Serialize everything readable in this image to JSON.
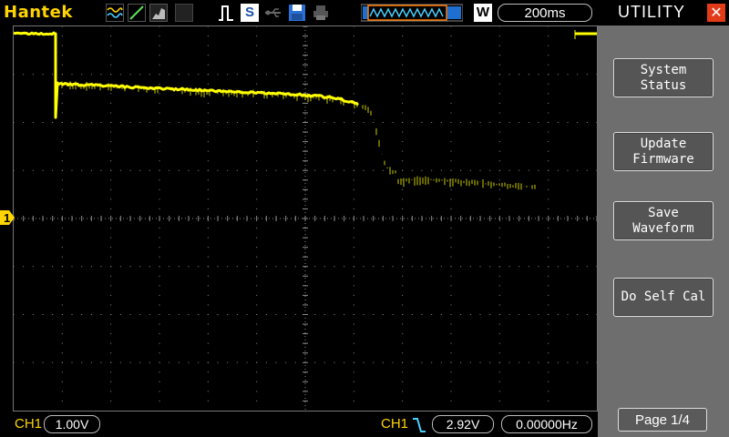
{
  "header": {
    "brand": "Hantek",
    "timebase": "200ms",
    "memory_mode": "W",
    "icons": [
      "waveform-mode-icon",
      "line-mode-icon",
      "persist-icon",
      "trigger-run-icon",
      "s-icon",
      "usb-icon",
      "save-disk-icon",
      "printer-icon",
      "memory-window-icon"
    ]
  },
  "sidebar": {
    "title": "UTILITY",
    "close_icon": "close-icon",
    "buttons": [
      {
        "line1": "System",
        "line2": "Status"
      },
      {
        "line1": "Update",
        "line2": "Firmware"
      },
      {
        "line1": "Save",
        "line2": "Waveform"
      },
      {
        "line1": "Do Self Cal",
        "line2": ""
      }
    ],
    "page": "Page 1/4"
  },
  "footer": {
    "ch1_label": "CH1",
    "ch1_scale": "1.00V",
    "trigger_source": "CH1",
    "trigger_level": "2.92V",
    "frequency": "0.00000Hz"
  },
  "channel_marker": "1",
  "colors": {
    "trace": "#ffff00",
    "brand": "#ffd400",
    "grid": "#8a8a8a",
    "panel": "#6e6e6e",
    "close": "#e23b1a"
  }
}
